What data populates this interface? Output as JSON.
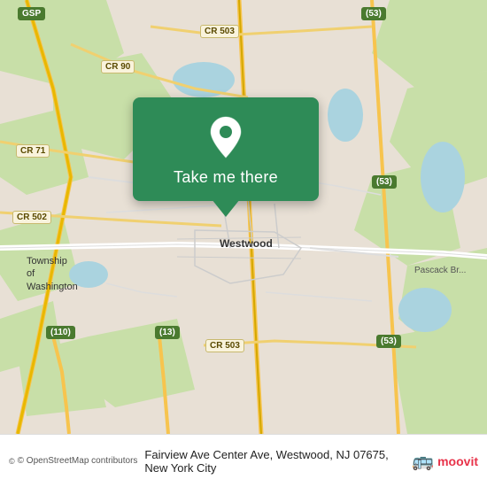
{
  "map": {
    "background_color": "#e8e0d8",
    "center_lat": 40.99,
    "center_lon": -74.03
  },
  "card": {
    "button_label": "Take me there",
    "background_color": "#2e8b57",
    "pin_color": "white"
  },
  "bottom_bar": {
    "osm_credit": "© OpenStreetMap contributors",
    "address": "Fairview Ave Center Ave, Westwood, NJ 07675, New York City",
    "moovit_label": "moovit"
  },
  "labels": {
    "cr503_top": "CR 503",
    "cr90": "CR 90",
    "cr71": "CR 71",
    "gsp": "GSP",
    "route53_top": "(53)",
    "route53_mid": "(53)",
    "route53_btm": "(53)",
    "cr502": "CR 502",
    "cr503_btm": "CR 503",
    "route110": "(110)",
    "route13": "(13)",
    "westwood": "Westwood",
    "township_washington": "Township\nof\nWashington",
    "pascack_brook": "Pascack Br..."
  }
}
